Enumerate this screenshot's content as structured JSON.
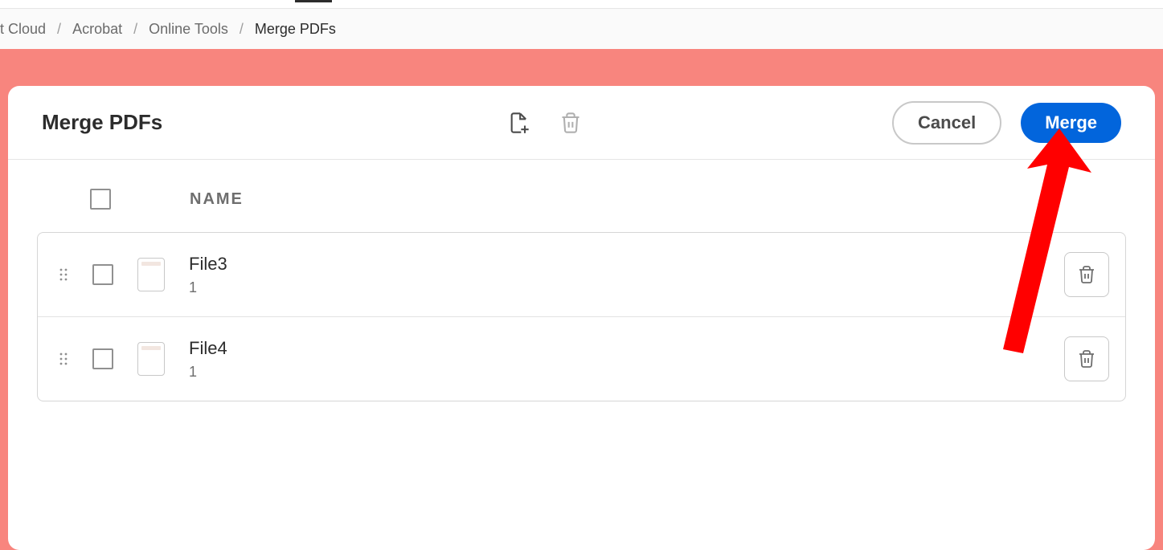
{
  "breadcrumb": {
    "items": [
      {
        "label": "t Cloud"
      },
      {
        "label": "Acrobat"
      },
      {
        "label": "Online Tools"
      }
    ],
    "current": "Merge PDFs"
  },
  "card": {
    "title": "Merge PDFs",
    "cancel_label": "Cancel",
    "merge_label": "Merge"
  },
  "table": {
    "header_name": "NAME"
  },
  "files": [
    {
      "name": "File3",
      "pages": "1"
    },
    {
      "name": "File4",
      "pages": "1"
    }
  ],
  "colors": {
    "accent_red": "#f8857e",
    "primary_blue": "#0265dc",
    "arrow_red": "#ff0000"
  }
}
